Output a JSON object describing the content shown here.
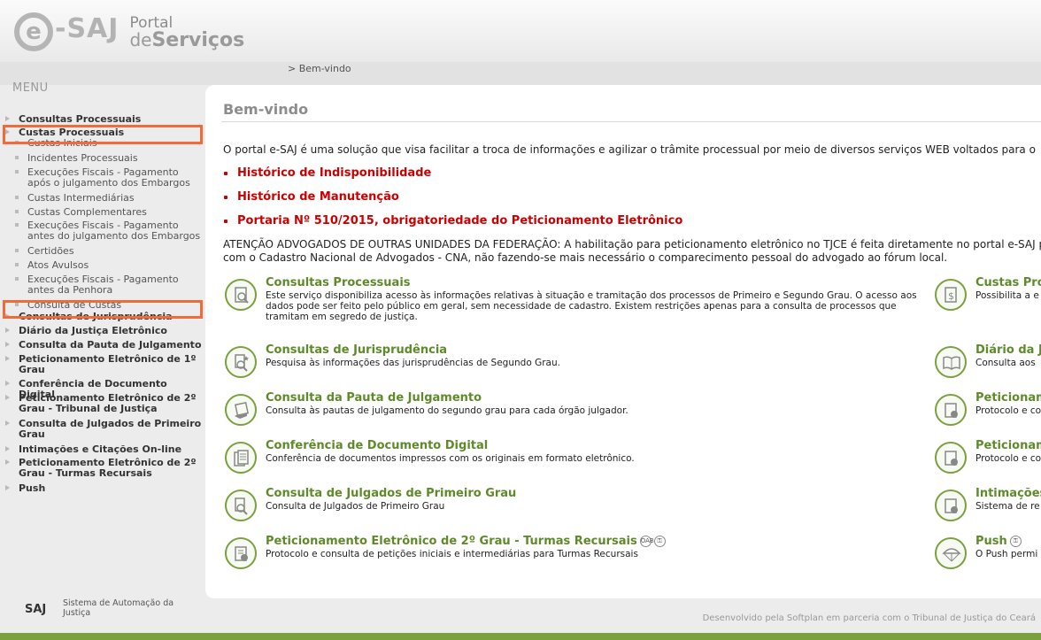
{
  "header": {
    "logo_text": "-SAJ",
    "logo_e": "e",
    "portal_line1": "Portal",
    "portal_de": "de",
    "portal_line2": "Serviços"
  },
  "breadcrumb": "> Bem-vindo",
  "menu": {
    "title": "MENU",
    "items": [
      {
        "label": "Consultas Processuais"
      },
      {
        "label": "Custas Processuais"
      },
      {
        "label": "Custas Iniciais"
      },
      {
        "label": "Incidentes Processuais"
      },
      {
        "label": "Execuções Fiscais - Pagamento após o julgamento dos Embargos"
      },
      {
        "label": "Custas Intermediárias"
      },
      {
        "label": "Custas Complementares"
      },
      {
        "label": "Execuções Fiscais - Pagamento antes do julgamento dos Embargos"
      },
      {
        "label": "Certidões"
      },
      {
        "label": "Atos Avulsos"
      },
      {
        "label": "Execuções Fiscais - Pagamento antes da Penhora"
      },
      {
        "label": "Consulta de Custas"
      },
      {
        "label": "Consultas de Jurisprudência"
      },
      {
        "label": "Diário da Justiça Eletrônico"
      },
      {
        "label": "Consulta da Pauta de Julgamento"
      },
      {
        "label": "Peticionamento Eletrônico de 1º Grau"
      },
      {
        "label": "Conferência de Documento Digital"
      },
      {
        "label": "Peticionamento Eletrônico de 2º Grau - Tribunal de Justiça"
      },
      {
        "label": "Consulta de Julgados de Primeiro Grau"
      },
      {
        "label": "Intimações e Citações On-line"
      },
      {
        "label": "Peticionamento Eletrônico de 2º Grau - Turmas Recursais"
      },
      {
        "label": "Push"
      }
    ]
  },
  "main": {
    "title": "Bem-vindo",
    "intro": "O portal e-SAJ é uma solução que visa facilitar a troca de informações e agilizar o trâmite processual por meio de diversos serviços WEB voltados para o",
    "links": [
      "Histórico de Indisponibilidade",
      "Histórico de Manutenção",
      "Portaria Nº 510/2015, obrigatoriedade do Peticionamento Eletrônico"
    ],
    "warning": "ATENÇÃO ADVOGADOS DE OUTRAS UNIDADES DA FEDERAÇÃO: A habilitação para peticionamento eletrônico no TJCE é feita diretamente no portal e-SAJ portal com o Cadastro Nacional de Advogados - CNA, não fazendo-se mais necessário o comparecimento pessoal do advogado ao fórum local.",
    "services_left": [
      {
        "title": "Consultas Processuais",
        "desc": "Este serviço disponibiliza acesso às informações relativas à situação e tramitação dos processos de Primeiro e Segundo Grau. O acesso aos dados pode ser feito pelo público em geral, sem necessidade de cadastro. Existem restrições apenas para a consulta de processos que tramitam em segredo de justiça."
      },
      {
        "title": "Consultas de Jurisprudência",
        "desc": "Pesquisa às informações das jurisprudências de Segundo Grau."
      },
      {
        "title": "Consulta da Pauta de Julgamento",
        "desc": "Consulta às pautas de julgamento do segundo grau para cada órgão julgador."
      },
      {
        "title": "Conferência de Documento Digital",
        "desc": "Conferência de documentos impressos com os originais em formato eletrônico."
      },
      {
        "title": "Consulta de Julgados de Primeiro Grau",
        "desc": "Consulta de Julgados de Primeiro Grau"
      },
      {
        "title": "Peticionamento Eletrônico de 2º Grau - Turmas Recursais",
        "desc": "Protocolo e consulta de petições iniciais e intermediárias para Turmas Recursais",
        "badge1": "OAB",
        "badge2": "⚿"
      }
    ],
    "services_right": [
      {
        "title": "Custas Pro",
        "desc": "Possibilita a e"
      },
      {
        "title": "Diário da J",
        "desc": "Consulta aos"
      },
      {
        "title": "Peticionam",
        "desc": "Protocolo e co"
      },
      {
        "title": "Peticionam",
        "desc": "Protocolo e co"
      },
      {
        "title": "Intimações",
        "desc": "Sistema de re"
      },
      {
        "title": "Push",
        "desc": "O Push permi",
        "badge": "⚿"
      }
    ]
  },
  "footer": {
    "logo": "SAJ",
    "system": "Sistema de Automação da Justiça",
    "developed": "Desenvolvido pela Softplan em parceria com o Tribunal de Justiça do Ceará"
  },
  "colors": {
    "accent_green": "#7aa13e",
    "link_red": "#cc0000",
    "highlight": "#f26a38"
  }
}
